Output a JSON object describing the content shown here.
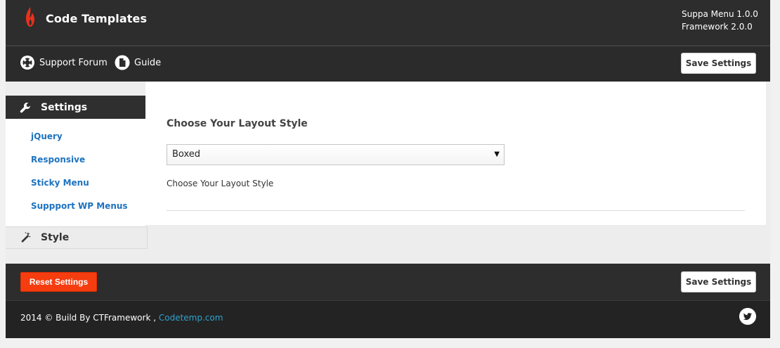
{
  "header": {
    "app_title": "Code Templates",
    "plugin_version": "Suppa Menu 1.0.0",
    "framework_version": "Framework 2.0.0"
  },
  "toolbar": {
    "support_label": "Support Forum",
    "guide_label": "Guide",
    "save_label": "Save Settings"
  },
  "sidebar": {
    "settings_label": "Settings",
    "items": [
      {
        "label": "jQuery"
      },
      {
        "label": "Responsive"
      },
      {
        "label": "Sticky Menu"
      },
      {
        "label": "Suppport WP Menus"
      }
    ],
    "style_label": "Style"
  },
  "main": {
    "field_title": "Choose Your Layout Style",
    "selected_value": "Boxed",
    "field_description": "Choose Your Layout Style"
  },
  "bottom_bar": {
    "reset_label": "Reset Settings",
    "save_label": "Save Settings"
  },
  "footer": {
    "copyright_text": "2014 © Build By CTFramework ,",
    "link_text": "Codetemp.com"
  },
  "colors": {
    "accent_red": "#f53d10",
    "link_blue": "#1e73be",
    "dark_bar": "#2d2d2d"
  }
}
